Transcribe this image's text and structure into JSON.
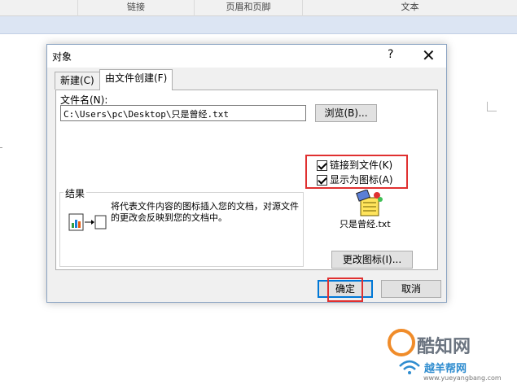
{
  "ribbon": {
    "groups": [
      "链接",
      "页眉和页脚",
      "文本"
    ]
  },
  "dialog": {
    "title": "对象",
    "help_symbol": "?",
    "close_symbol": "✕",
    "tabs": [
      {
        "label": "新建(C)",
        "active": false
      },
      {
        "label": "由文件创建(F)",
        "active": true
      }
    ],
    "filename_label": "文件名(N):",
    "filename_value": "C:\\Users\\pc\\Desktop\\只是曾经.txt",
    "browse_label": "浏览(B)...",
    "link_to_file_label": "链接到文件(K)",
    "link_to_file_checked": true,
    "display_as_icon_label": "显示为图标(A)",
    "display_as_icon_checked": true,
    "result_legend": "结果",
    "result_text": "将代表文件内容的图标插入您的文档，对源文件的更改会反映到您的文档中。",
    "icon_filename": "只是曾经.txt",
    "change_icon_label": "更改图标(I)...",
    "ok_label": "确定",
    "cancel_label": "取消"
  },
  "watermark": {
    "brand": "酷知网",
    "site": "越羊帮网",
    "url": "www.yueyangbang.com"
  },
  "colors": {
    "highlight": "#e03030",
    "accent": "#0078d7"
  }
}
